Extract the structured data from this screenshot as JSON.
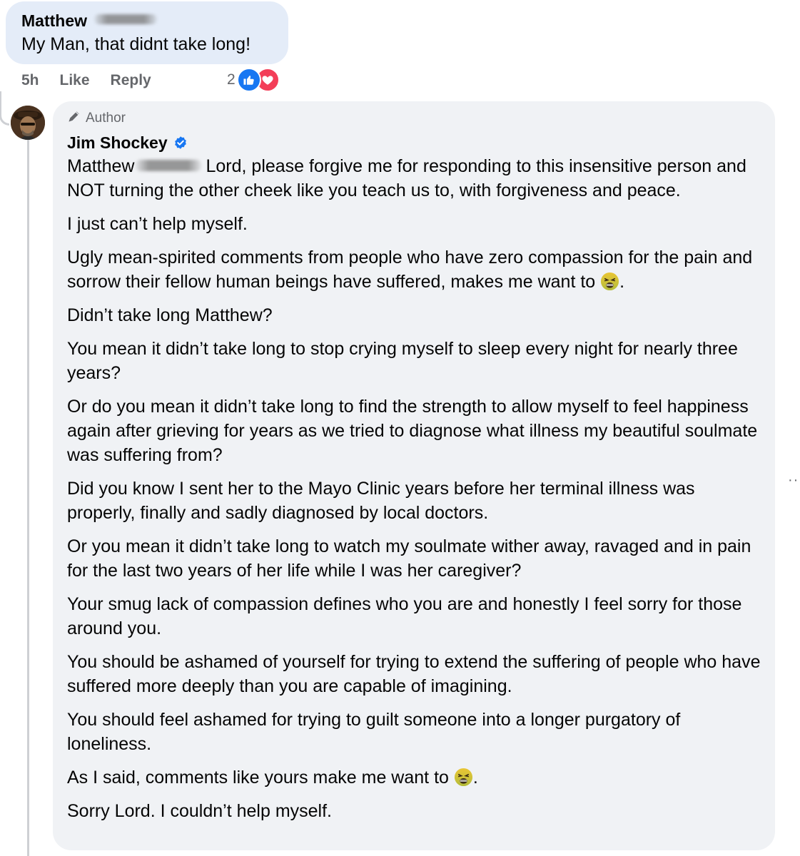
{
  "top_comment": {
    "author": "Matthew",
    "text": "My Man, that didnt take long!",
    "time": "5h",
    "like_label": "Like",
    "reply_label": "Reply",
    "reaction_count": "2",
    "reactions": [
      "like-icon",
      "love-icon"
    ]
  },
  "reply": {
    "author_badge": "Author",
    "author_name": "Jim Shockey",
    "mention": "Matthew",
    "paragraphs": [
      {
        "text": "Lord, please forgive me for responding to this insensitive person and NOT turning the other cheek like you teach us to, with forgiveness and peace."
      },
      {
        "text": "I just can’t help myself."
      },
      {
        "text": "Ugly mean-spirited comments from people who have zero compassion for the pain and sorrow their fellow human beings have suffered, makes me want to",
        "suffix": "."
      },
      {
        "text": "Didn’t take long Matthew?"
      },
      {
        "text": "You mean it didn’t take long to stop crying myself to sleep every night for nearly three years?"
      },
      {
        "text": "Or do you mean it didn’t take long to find the strength to allow myself to feel happiness again after grieving for years as we tried to diagnose what illness my beautiful soulmate was suffering from?"
      },
      {
        "text": "Did you know I sent her to the Mayo Clinic years before her terminal illness was properly, finally and sadly diagnosed by local doctors."
      },
      {
        "text": "Or you mean it didn’t take long to watch my soulmate wither away, ravaged and in pain for the last two years of her life while I was her caregiver?"
      },
      {
        "text": "Your smug lack of compassion defines who you are and honestly I feel sorry for those around you."
      },
      {
        "text": "You should be ashamed of yourself for trying to extend the suffering of people who have suffered more deeply than you are capable of imagining."
      },
      {
        "text": "You should feel ashamed for trying to guilt someone into a longer purgatory of loneliness."
      },
      {
        "text": "As I said, comments like yours make me want to",
        "suffix": "."
      },
      {
        "text": "Sorry Lord. I couldn’t help myself."
      }
    ],
    "more_label": "··"
  },
  "colors": {
    "top_bubble": "#e4ecf8",
    "reply_bubble": "#f0f2f5",
    "meta_text": "#65676b",
    "like_blue": "#1877f2",
    "love_red": "#f33e58",
    "verified_blue": "#1877f2"
  }
}
